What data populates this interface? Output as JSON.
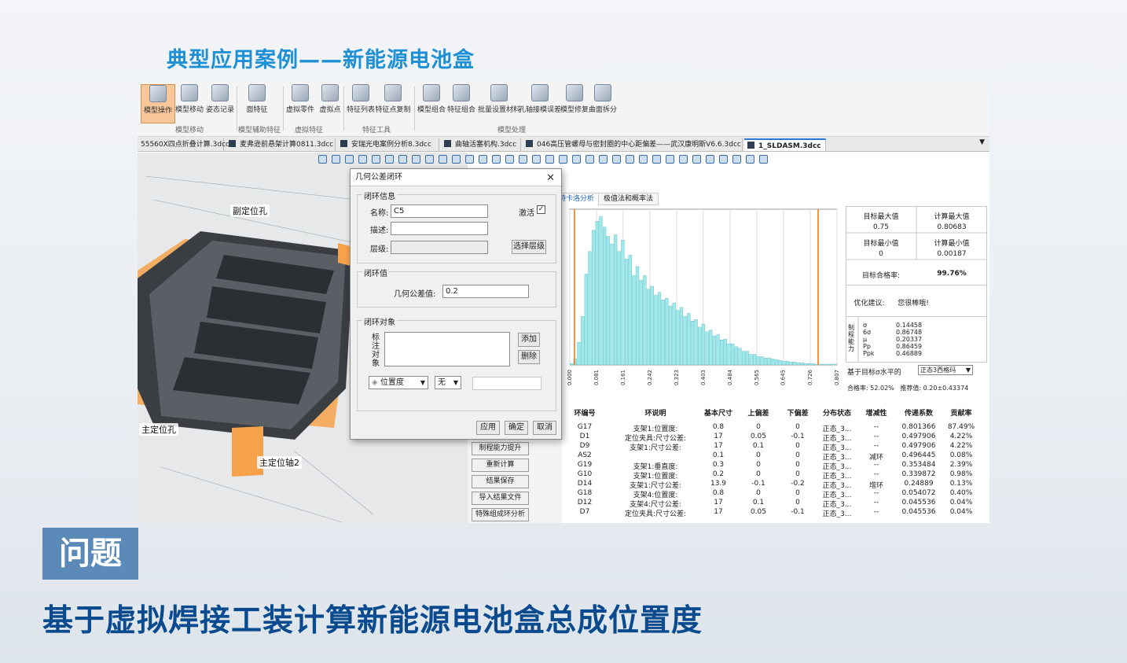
{
  "slide": {
    "title": "典型应用案例——新能源电池盒",
    "badge": "问题",
    "headline": "基于虚拟焊接工装计算新能源电池盒总成位置度"
  },
  "toolbar": {
    "buttons": [
      {
        "label": "模型操作",
        "icon": "model-op-icon",
        "active": true
      },
      {
        "label": "模型移动",
        "icon": "model-move-icon"
      },
      {
        "label": "姿态记录",
        "icon": "pose-record-icon"
      },
      {
        "label": "面特征",
        "icon": "face-feature-icon"
      },
      {
        "label": "虚拟零件",
        "icon": "virtual-part-icon"
      },
      {
        "label": "虚拟点",
        "icon": "virtual-point-icon"
      },
      {
        "label": "特征列表",
        "icon": "feature-list-icon"
      },
      {
        "label": "特征点复制",
        "icon": "feature-copy-icon"
      },
      {
        "label": "模型组合",
        "icon": "model-combine-icon"
      },
      {
        "label": "特征组合",
        "icon": "feature-combine-icon"
      },
      {
        "label": "批量设置材料",
        "icon": "batch-material-icon"
      },
      {
        "label": "孔轴接模误差",
        "icon": "hole-shaft-icon"
      },
      {
        "label": "模型修复",
        "icon": "model-repair-icon"
      },
      {
        "label": "曲面拆分",
        "icon": "surface-split-icon"
      }
    ],
    "groups": [
      "模型移动",
      "模型辅助特征",
      "虚拟特征",
      "特征工具",
      "模型处理"
    ]
  },
  "tabs": [
    {
      "label": "55560X四点折叠计算.3dcc"
    },
    {
      "label": "麦弗逊前悬架计算0811.3dcc"
    },
    {
      "label": "安瑞光电案例分析8.3dcc"
    },
    {
      "label": "曲轴活塞机构.3dcc"
    },
    {
      "label": "046高压管螺母与密封圈的中心距偏差——武汉康明斯V6.6.3dcc"
    },
    {
      "label": "1_SLDASM.3dcc",
      "active": true
    }
  ],
  "view3d": {
    "labels": [
      "副定位孔",
      "主定位孔",
      "主定位轴2"
    ]
  },
  "dialog": {
    "title": "几何公差闭环",
    "section_info": "闭环信息",
    "name_label": "名称:",
    "name_value": "C5",
    "activate_label": "激活",
    "activate_checked": "✓",
    "desc_label": "描述:",
    "level_label": "层级:",
    "select_level": "选择层级",
    "section_value": "闭环值",
    "tol_label": "几何公差值:",
    "tol_value": "0.2",
    "section_obj": "闭环对象",
    "mark_label": "标注对象",
    "add": "添加",
    "delete": "删除",
    "select_type": "位置度",
    "select_none": "无",
    "apply": "应用",
    "ok": "确定",
    "cancel": "取消"
  },
  "analysis": {
    "tabs": [
      "蒙特卡洛分析",
      "极值法和概率法"
    ],
    "stats": {
      "target_max_label": "目标最大值",
      "target_max": "0.75",
      "calc_max_label": "计算最大值",
      "calc_max": "0.80683",
      "target_min_label": "目标最小值",
      "target_min": "0",
      "calc_min_label": "计算最小值",
      "calc_min": "0.00187",
      "pass_label": "目标合格率:",
      "pass_value": "99.76%",
      "suggest_label": "优化建议:",
      "suggest_value": "您很棒哦!",
      "cap_label": "制程能力",
      "sigma_label": "σ",
      "sigma": "0.14458",
      "six_sigma_label": "6σ",
      "six_sigma": "0.86748",
      "mu_label": "μ",
      "mu": "0.20337",
      "pp_label": "Pp",
      "pp": "0.86459",
      "ppk_label": "Ppk",
      "ppk": "0.46889",
      "basis_label": "基于目标σ水平的",
      "basis_value": "正态3西格玛",
      "rate_label": "合格率:",
      "rate_value": "52.02%",
      "recommend_label": "推荐值:",
      "recommend_value": "0.20±0.43374"
    },
    "side_buttons": [
      "制程能力提升",
      "重新计算",
      "结果保存",
      "导入结果文件",
      "特殊组成环分析"
    ],
    "table": {
      "headers": [
        "环编号",
        "环说明",
        "基本尺寸",
        "上偏差",
        "下偏差",
        "分布状态",
        "增减性",
        "传递系数",
        "贡献率"
      ],
      "rows": [
        [
          "G17",
          "支架1:位置度:",
          "0.8",
          "0",
          "0",
          "正态_3...",
          "--",
          "0.801366",
          "87.49%"
        ],
        [
          "D1",
          "定位夹具:尺寸公差:",
          "17",
          "0.05",
          "-0.1",
          "正态_3...",
          "--",
          "0.497906",
          "4.22%"
        ],
        [
          "D9",
          "支架1:尺寸公差:",
          "17",
          "0.1",
          "0",
          "正态_3...",
          "--",
          "0.497906",
          "4.22%"
        ],
        [
          "AS2",
          "",
          "0.1",
          "0",
          "0",
          "正态_3...",
          "减环",
          "0.496445",
          "0.08%"
        ],
        [
          "G19",
          "支架1:垂直度:",
          "0.3",
          "0",
          "0",
          "正态_3...",
          "--",
          "0.353484",
          "2.39%"
        ],
        [
          "G10",
          "支架1:位置度:",
          "0.2",
          "0",
          "0",
          "正态_3...",
          "--",
          "0.339872",
          "0.98%"
        ],
        [
          "D14",
          "支架1:尺寸公差:",
          "13.9",
          "-0.1",
          "-0.2",
          "正态_3...",
          "增环",
          "0.24889",
          "0.13%"
        ],
        [
          "G18",
          "支架4:位置度:",
          "0.8",
          "0",
          "0",
          "正态_3...",
          "--",
          "0.054072",
          "0.40%"
        ],
        [
          "D12",
          "支架4:尺寸公差:",
          "17",
          "0.1",
          "0",
          "正态_3...",
          "--",
          "0.045536",
          "0.04%"
        ],
        [
          "D7",
          "定位夹具:尺寸公差:",
          "17",
          "0.05",
          "-0.1",
          "正态_3...",
          "--",
          "0.045536",
          "0.04%"
        ]
      ]
    }
  },
  "chart_data": {
    "type": "bar",
    "x_ticks": [
      "0.000",
      "0.081",
      "0.161",
      "0.242",
      "0.323",
      "0.403",
      "0.484",
      "0.565",
      "0.645",
      "0.726",
      "0.807"
    ],
    "xlim": [
      0,
      0.807
    ],
    "limits": [
      0,
      0.75
    ],
    "values": [
      2,
      8,
      30,
      64,
      120,
      150,
      178,
      190,
      196,
      182,
      170,
      160,
      172,
      150,
      165,
      140,
      145,
      118,
      130,
      112,
      118,
      100,
      104,
      92,
      96,
      86,
      88,
      78,
      82,
      72,
      76,
      64,
      68,
      58,
      60,
      50,
      54,
      44,
      46,
      38,
      40,
      33,
      34,
      28,
      28,
      24,
      22,
      18,
      18,
      14,
      14,
      11,
      11,
      9,
      9,
      8,
      7,
      6,
      5,
      5,
      4,
      4,
      3,
      3,
      2,
      2,
      2,
      1,
      1,
      1,
      1,
      1,
      1
    ]
  }
}
